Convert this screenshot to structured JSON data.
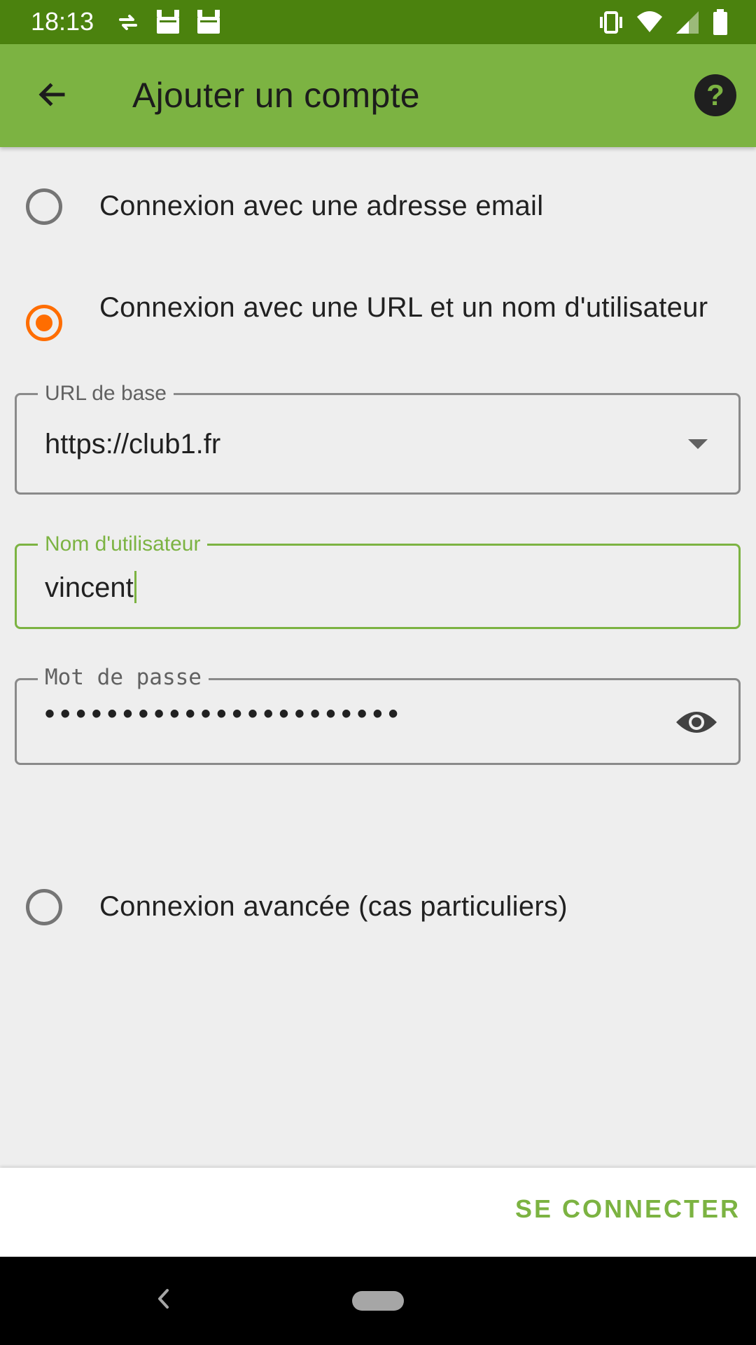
{
  "status_bar": {
    "time": "18:13",
    "left_icons": [
      "data-sync-icon",
      "android-notification-icon",
      "android-notification-icon"
    ],
    "right_icons": [
      "vibrate-icon",
      "wifi-icon",
      "cell-signal-icon",
      "battery-icon"
    ]
  },
  "app_bar": {
    "title": "Ajouter un compte",
    "back_icon": "arrow-back-icon",
    "help_icon": "help-icon",
    "help_glyph": "?"
  },
  "options": {
    "email": {
      "label": "Connexion avec une adresse email",
      "checked": false
    },
    "url": {
      "label": "Connexion avec une URL et un nom d'utilisateur",
      "checked": true
    },
    "advanced": {
      "label": "Connexion avancée (cas particuliers)",
      "checked": false
    }
  },
  "fields": {
    "base_url": {
      "label": "URL de base",
      "value": "https://club1.fr"
    },
    "username": {
      "label": "Nom d'utilisateur",
      "value": "vincent"
    },
    "password": {
      "label": "Mot de passe",
      "value": "•••••••••••••••••••••••"
    }
  },
  "actions": {
    "connect_label": "SE CONNECTER"
  },
  "colors": {
    "status_bar": "#4b820e",
    "app_bar": "#7cb342",
    "accent": "#ff6d00",
    "focus": "#7cb342",
    "background": "#eeeeee"
  }
}
